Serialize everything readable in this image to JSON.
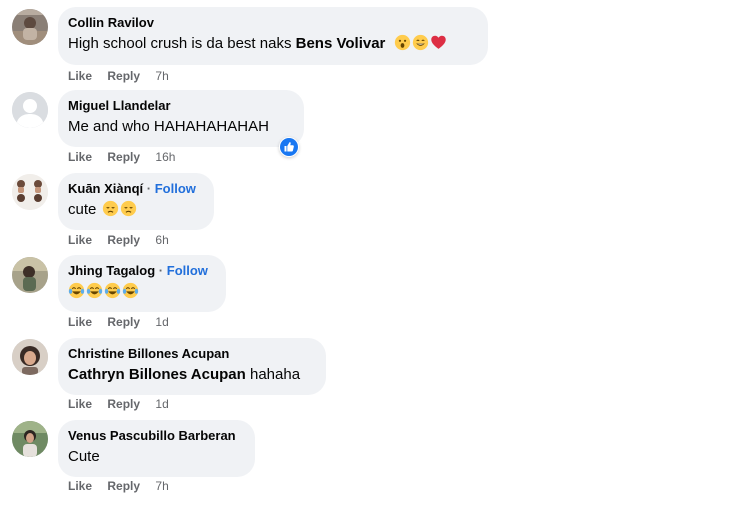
{
  "actions": {
    "like": "Like",
    "reply": "Reply"
  },
  "follow_label": "Follow",
  "comments": [
    {
      "author": "Collin Ravilov",
      "text": "High school crush is da best naks ",
      "mention": "Bens Volivar",
      "emojis": [
        "astonished-face-emoji",
        "grinning-face-emoji",
        "red-heart-emoji"
      ],
      "time": "7h"
    },
    {
      "author": "Miguel Llandelar",
      "text": "Me and who HAHAHAHAHAH",
      "reaction": "like-reaction-icon",
      "time": "16h"
    },
    {
      "author": "Kuān Xiànqí",
      "follow": true,
      "text": "cute ",
      "emojis": [
        "disappointed-face-emoji",
        "disappointed-face-emoji"
      ],
      "time": "6h"
    },
    {
      "author": "Jhing Tagalog",
      "follow": true,
      "text": "",
      "emojis": [
        "face-with-tears-of-joy-emoji",
        "face-with-tears-of-joy-emoji",
        "face-with-tears-of-joy-emoji",
        "face-with-tears-of-joy-emoji"
      ],
      "time": "1d"
    },
    {
      "author": "Christine Billones Acupan",
      "mention": "Cathryn Billones Acupan",
      "text": " hahaha",
      "time": "1d"
    },
    {
      "author": "Venus Pascubillo Barberan",
      "text": "Cute",
      "time": "7h"
    }
  ],
  "colors": {
    "bubble": "#f0f2f5",
    "follow": "#216fdb",
    "meta": "#65676b",
    "like_blue": "#1877f2"
  }
}
